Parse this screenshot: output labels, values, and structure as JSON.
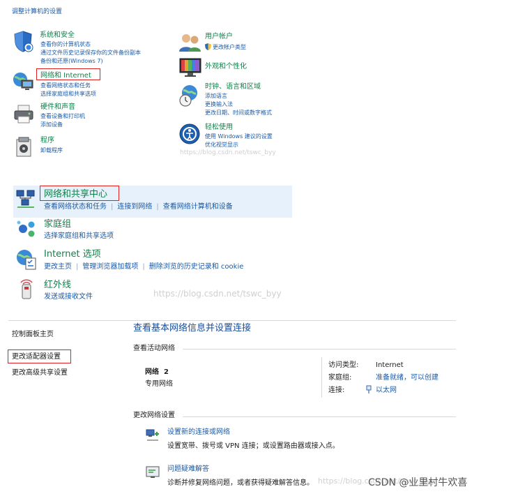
{
  "top_section": {
    "title": "调整计算机的设置",
    "categories": [
      {
        "name": "系统和安全",
        "links": [
          "查看你的计算机状态",
          "通过文件历史记录保存你的文件备份副本",
          "备份和还原(Windows 7)"
        ]
      },
      {
        "name": "网络和 Internet",
        "links": [
          "查看网络状态和任务",
          "选择家庭组和共享选项"
        ]
      },
      {
        "name": "硬件和声音",
        "links": [
          "查看设备和打印机",
          "添加设备"
        ]
      },
      {
        "name": "程序",
        "links": [
          "卸载程序"
        ]
      },
      {
        "name": "用户帐户",
        "links": [
          "更改帐户类型"
        ]
      },
      {
        "name": "外观和个性化",
        "links": []
      },
      {
        "name": "时钟、语言和区域",
        "links": [
          "添加语言",
          "更换输入法",
          "更改日期、时间或数字格式"
        ]
      },
      {
        "name": "轻松使用",
        "links": [
          "使用 Windows 建议的设置",
          "优化视觉显示"
        ]
      }
    ],
    "watermark": "https://blog.csdn.net/tswc_byy"
  },
  "middle_section": {
    "items": [
      {
        "name": "网络和共享中心",
        "links": [
          "查看网络状态和任务",
          "连接到网络",
          "查看网络计算机和设备"
        ]
      },
      {
        "name": "家庭组",
        "links": [
          "选择家庭组和共享选项"
        ]
      },
      {
        "name": "Internet 选项",
        "links": [
          "更改主页",
          "管理浏览器加载项",
          "删除浏览的历史记录和 cookie"
        ]
      },
      {
        "name": "红外线",
        "links": [
          "发送或接收文件"
        ]
      }
    ],
    "watermark": "https://blog.csdn.net/tswc_byy"
  },
  "bottom_section": {
    "sidebar": [
      "控制面板主页",
      "更改适配器设置",
      "更改高级共享设置"
    ],
    "heading": "查看基本网络信息并设置连接",
    "active_networks_label": "查看活动网络",
    "network": {
      "name": "网络  2",
      "type": "专用网络",
      "access_type_label": "访问类型:",
      "access_type_value": "Internet",
      "homegroup_label": "家庭组:",
      "homegroup_value": "准备就绪，可以创建",
      "connection_label": "连接:",
      "connection_value": "以太网"
    },
    "change_settings_label": "更改网络设置",
    "actions": [
      {
        "title": "设置新的连接或网络",
        "desc": "设置宽带、拨号或 VPN 连接；或设置路由器或接入点。"
      },
      {
        "title": "问题疑难解答",
        "desc": "诊断并修复网络问题，或者获得疑难解答信息。"
      }
    ],
    "watermark": "https://blog.csdn.net/tswc_byy"
  },
  "credit": "CSDN @业里村牛欢喜"
}
